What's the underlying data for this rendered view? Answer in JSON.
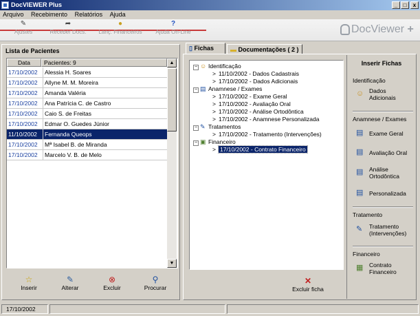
{
  "window": {
    "title": "DocVIEWER Plus",
    "min": "_",
    "max": "□",
    "close": "x"
  },
  "menu": [
    "Arquivo",
    "Recebimento",
    "Relatórios",
    "Ajuda"
  ],
  "toolbar": [
    {
      "label": "Ajustes",
      "icon": "wrench-icon",
      "glyph": "✎"
    },
    {
      "label": "Receber Docs.",
      "icon": "folder-arrow-icon",
      "glyph": "➦"
    },
    {
      "label": "Lanç. Financeiros",
      "icon": "coins-icon",
      "glyph": "●"
    },
    {
      "label": "Ajuda On-Line",
      "icon": "help-icon",
      "glyph": "?"
    }
  ],
  "logo": {
    "text": "DocViewer",
    "plus": "+"
  },
  "patients": {
    "title": "Lista de Pacientes",
    "col_date": "Data",
    "col_patients": "Pacientes: 9",
    "rows": [
      {
        "date": "17/10/2002",
        "name": "Alessia H. Soares"
      },
      {
        "date": "17/10/2002",
        "name": "Allyne M. M. Moreira"
      },
      {
        "date": "17/10/2002",
        "name": "Amanda Valéria"
      },
      {
        "date": "17/10/2002",
        "name": "Ana Patrícia C. de Castro"
      },
      {
        "date": "17/10/2002",
        "name": "Caio S. de Freitas"
      },
      {
        "date": "17/10/2002",
        "name": "Edmar O. Guedes Júnior"
      },
      {
        "date": "11/10/2002",
        "name": "Fernanda Queops"
      },
      {
        "date": "17/10/2002",
        "name": "Mª Isabel B. de Miranda"
      },
      {
        "date": "17/10/2002",
        "name": "Marcelo V. B. de Melo"
      }
    ],
    "selected_index": 6,
    "buttons": [
      {
        "label": "Inserir",
        "glyph": "☆"
      },
      {
        "label": "Alterar",
        "glyph": "✎"
      },
      {
        "label": "Excluir",
        "glyph": "⊗"
      },
      {
        "label": "Procurar",
        "glyph": "⚲"
      }
    ]
  },
  "tabs": [
    {
      "label": "Fichas",
      "active": true
    },
    {
      "label": "Documentações ( 2 )",
      "active": false
    }
  ],
  "tree": [
    {
      "label": "Identificação",
      "children": [
        "11/10/2002 - Dados Cadastrais",
        "17/10/2002 - Dados Adicionais"
      ]
    },
    {
      "label": "Anamnese / Exames",
      "children": [
        "17/10/2002 - Exame Geral",
        "17/10/2002 - Avaliação Oral",
        "17/10/2002 - Análise Ortodôntica",
        "17/10/2002 - Anamnese Personalizada"
      ]
    },
    {
      "label": "Tratamentos",
      "children": [
        "17/10/2002 - Tratamento (Intervenções)"
      ]
    },
    {
      "label": "Financeiro",
      "children": [
        "17/10/2002 - Contrato Financeiro"
      ]
    }
  ],
  "excluir_ficha": "Excluir ficha",
  "side": {
    "title": "Inserir Fichas",
    "sections": [
      {
        "title": "Identificação",
        "items": [
          [
            "Dados",
            "Adicionais"
          ]
        ]
      },
      {
        "title": "Anamnese / Exames",
        "items": [
          [
            "Exame Geral"
          ],
          [
            "Avaliação Oral"
          ],
          [
            "Análise",
            "Ortodôntica"
          ],
          [
            "Personalizada"
          ]
        ]
      },
      {
        "title": "Tratamento",
        "items": [
          [
            "Tratamento",
            "(Intervenções)"
          ]
        ]
      },
      {
        "title": "Financeiro",
        "items": [
          [
            "Contrato",
            "Financeiro"
          ]
        ]
      }
    ]
  },
  "status": {
    "date": "17/10/2002"
  }
}
